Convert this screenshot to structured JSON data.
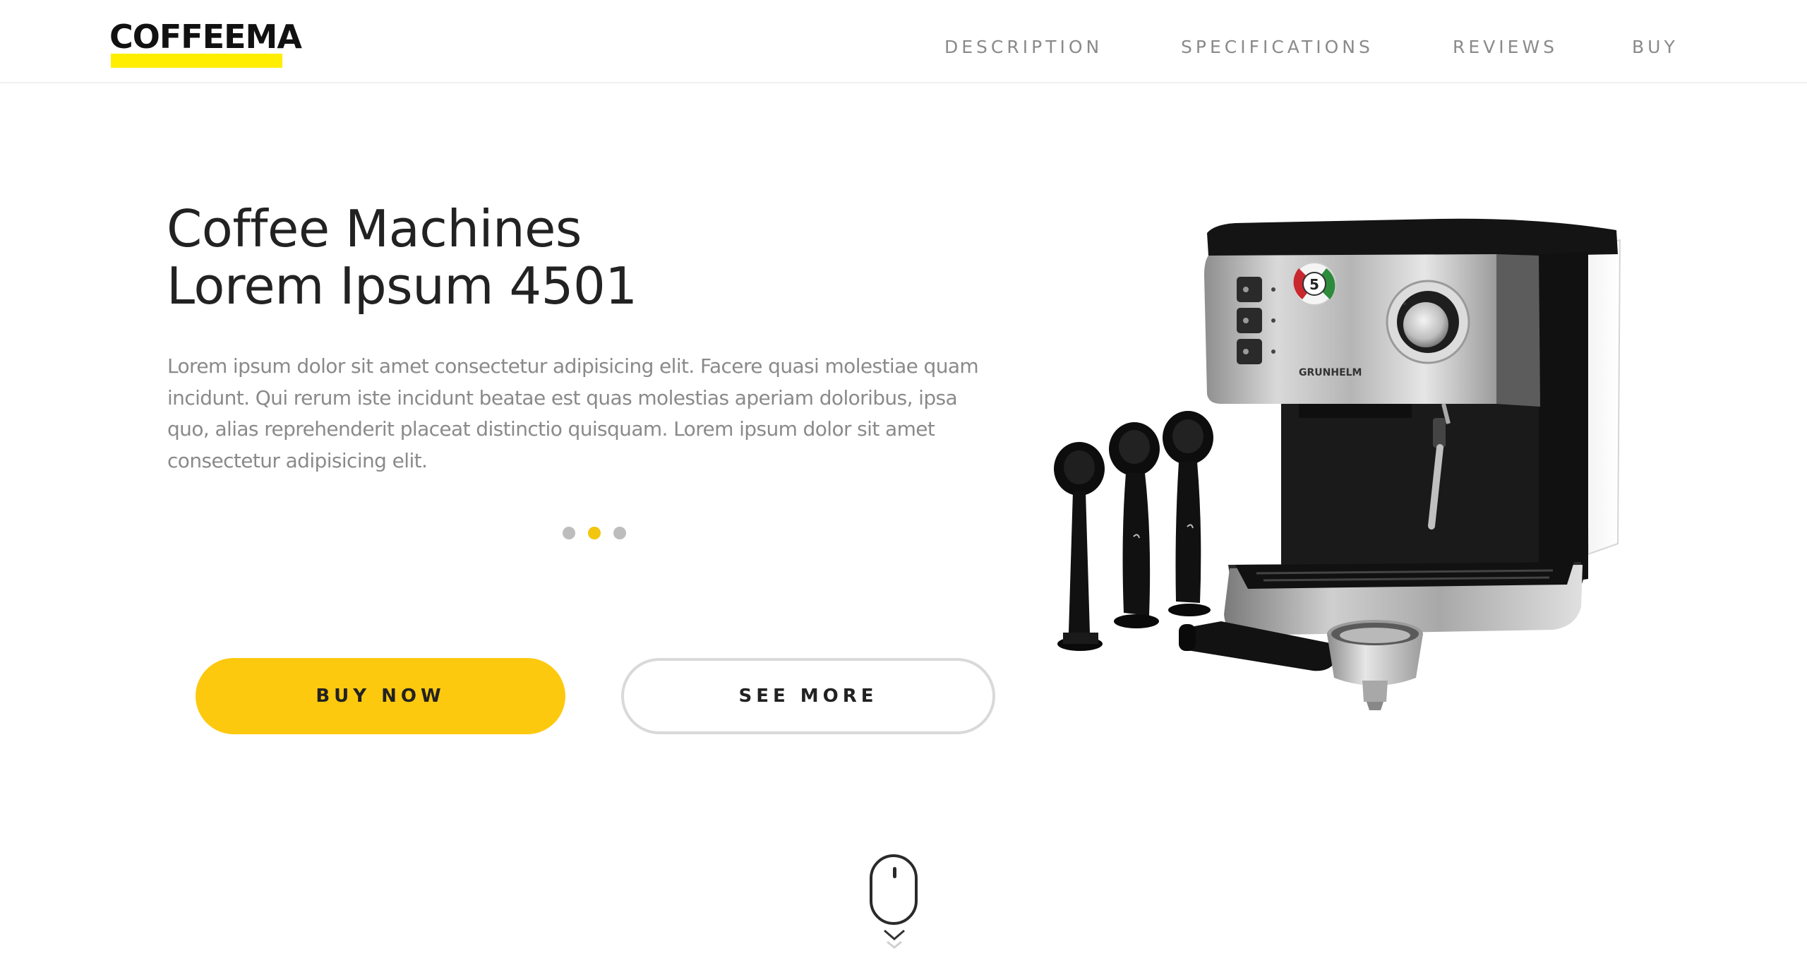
{
  "brand": {
    "logo_text": "COFFEEMA",
    "underline_color": "#ffee00"
  },
  "nav": {
    "items": [
      {
        "label": "DESCRIPTION"
      },
      {
        "label": "SPECIFICATIONS"
      },
      {
        "label": "REVIEWS"
      },
      {
        "label": "BUY"
      }
    ]
  },
  "hero": {
    "title_line1": "Coffee Machines",
    "title_line2": "Lorem Ipsum 4501",
    "description": "Lorem ipsum dolor sit amet consectetur adipisicing elit. Facere quasi molestiae quam incidunt. Qui rerum iste incidunt beatae est quas molestias aperiam doloribus, ipsa quo, alias reprehenderit placeat distinctio quisquam. Lorem ipsum dolor sit amet consectetur adipisicing elit.",
    "carousel": {
      "slide_count": 3,
      "active_index": 1
    },
    "buttons": {
      "primary_label": "BUY NOW",
      "secondary_label": "SEE MORE"
    }
  },
  "product_image": {
    "subject": "espresso-machine",
    "brand_mark": "GRUNHELM",
    "badge_text": "5"
  },
  "scroll_indicator": {
    "icon": "mouse-scroll-icon"
  },
  "colors": {
    "accent": "#fdc90f",
    "dot_active": "#f2c511",
    "dot_inactive": "#bdbdbd",
    "text_dark": "#222222",
    "text_muted": "#8a8a8a"
  }
}
